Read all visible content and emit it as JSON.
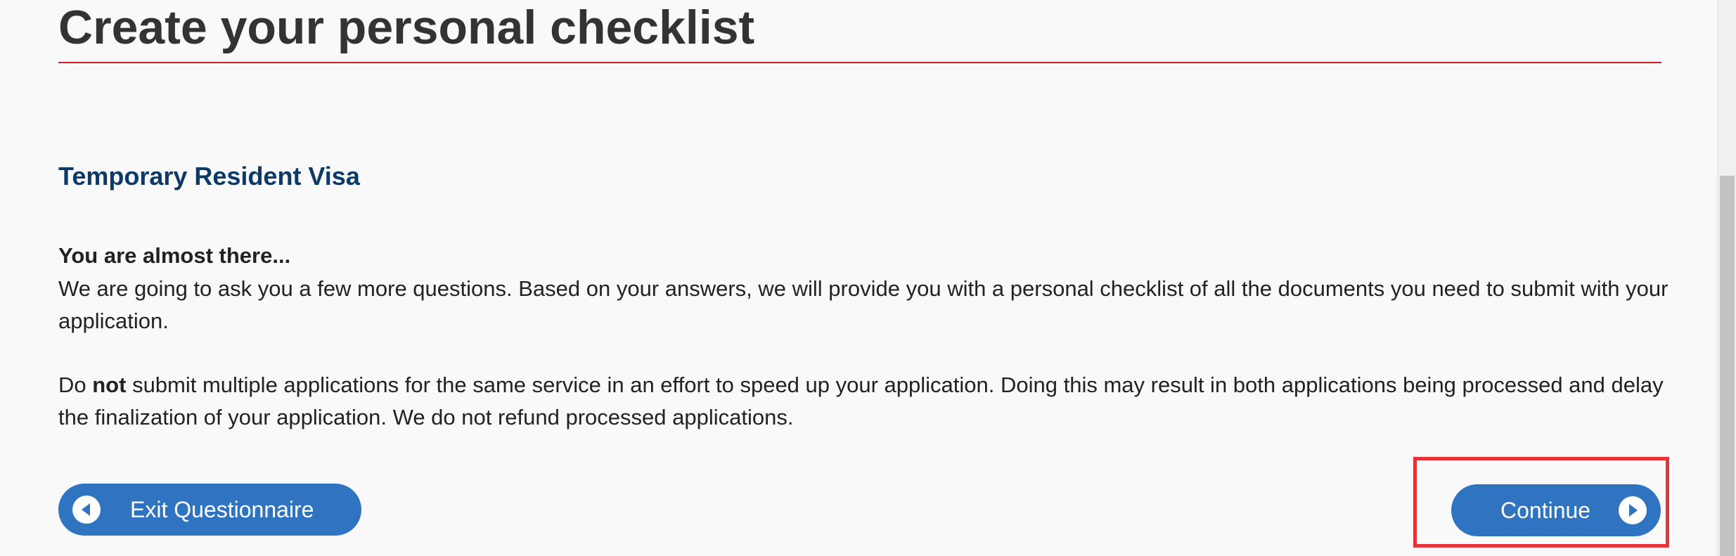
{
  "page": {
    "title": "Create your personal checklist",
    "subheading": "Temporary Resident Visa"
  },
  "content": {
    "almost_there": "You are almost there...",
    "intro": "We are going to ask you a few more questions. Based on your answers, we will provide you with a personal checklist of all the documents you need to submit with your application.",
    "warning_prefix": "Do ",
    "warning_emphasis": "not",
    "warning_rest": " submit multiple applications for the same service in an effort to speed up your application.  Doing this may result in both applications being processed and delay the finalization of your application.  We do not refund processed applications."
  },
  "buttons": {
    "exit_label": "Exit Questionnaire",
    "exit_icon": "chevron-left-circle-icon",
    "continue_label": "Continue",
    "continue_icon": "chevron-right-circle-icon"
  },
  "colors": {
    "title_rule": "#c9202c",
    "subheading": "#0b3a69",
    "button": "#2f74c0",
    "highlight": "#e5323b"
  }
}
